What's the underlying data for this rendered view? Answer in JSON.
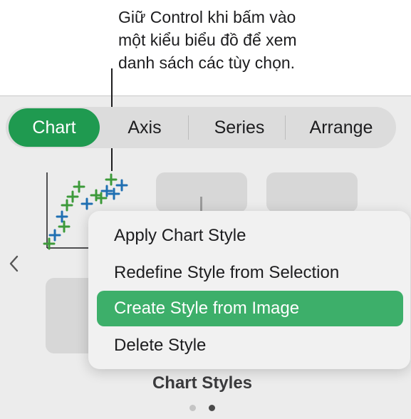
{
  "callout": {
    "lines": [
      "Giữ Control khi bấm vào",
      "một kiểu biểu đồ để xem",
      "danh sách các tùy chọn."
    ]
  },
  "tabs": [
    {
      "label": "Chart",
      "active": true
    },
    {
      "label": "Axis",
      "active": false
    },
    {
      "label": "Series",
      "active": false
    },
    {
      "label": "Arrange",
      "active": false
    }
  ],
  "context_menu": {
    "items": [
      {
        "label": "Apply Chart Style",
        "highlighted": false
      },
      {
        "label": "Redefine Style from Selection",
        "highlighted": false
      },
      {
        "label": "Create Style from Image",
        "highlighted": true
      },
      {
        "label": "Delete Style",
        "highlighted": false
      }
    ]
  },
  "section": {
    "label": "Chart Styles"
  },
  "pagination": {
    "pages": 2,
    "current": 2
  },
  "icons": {
    "prev": "chevron-left-icon"
  },
  "colors": {
    "accent": "#1f9a50",
    "highlight": "#3daf6a",
    "marker_green": "#3d9a3a",
    "marker_blue": "#1f6fb2"
  }
}
